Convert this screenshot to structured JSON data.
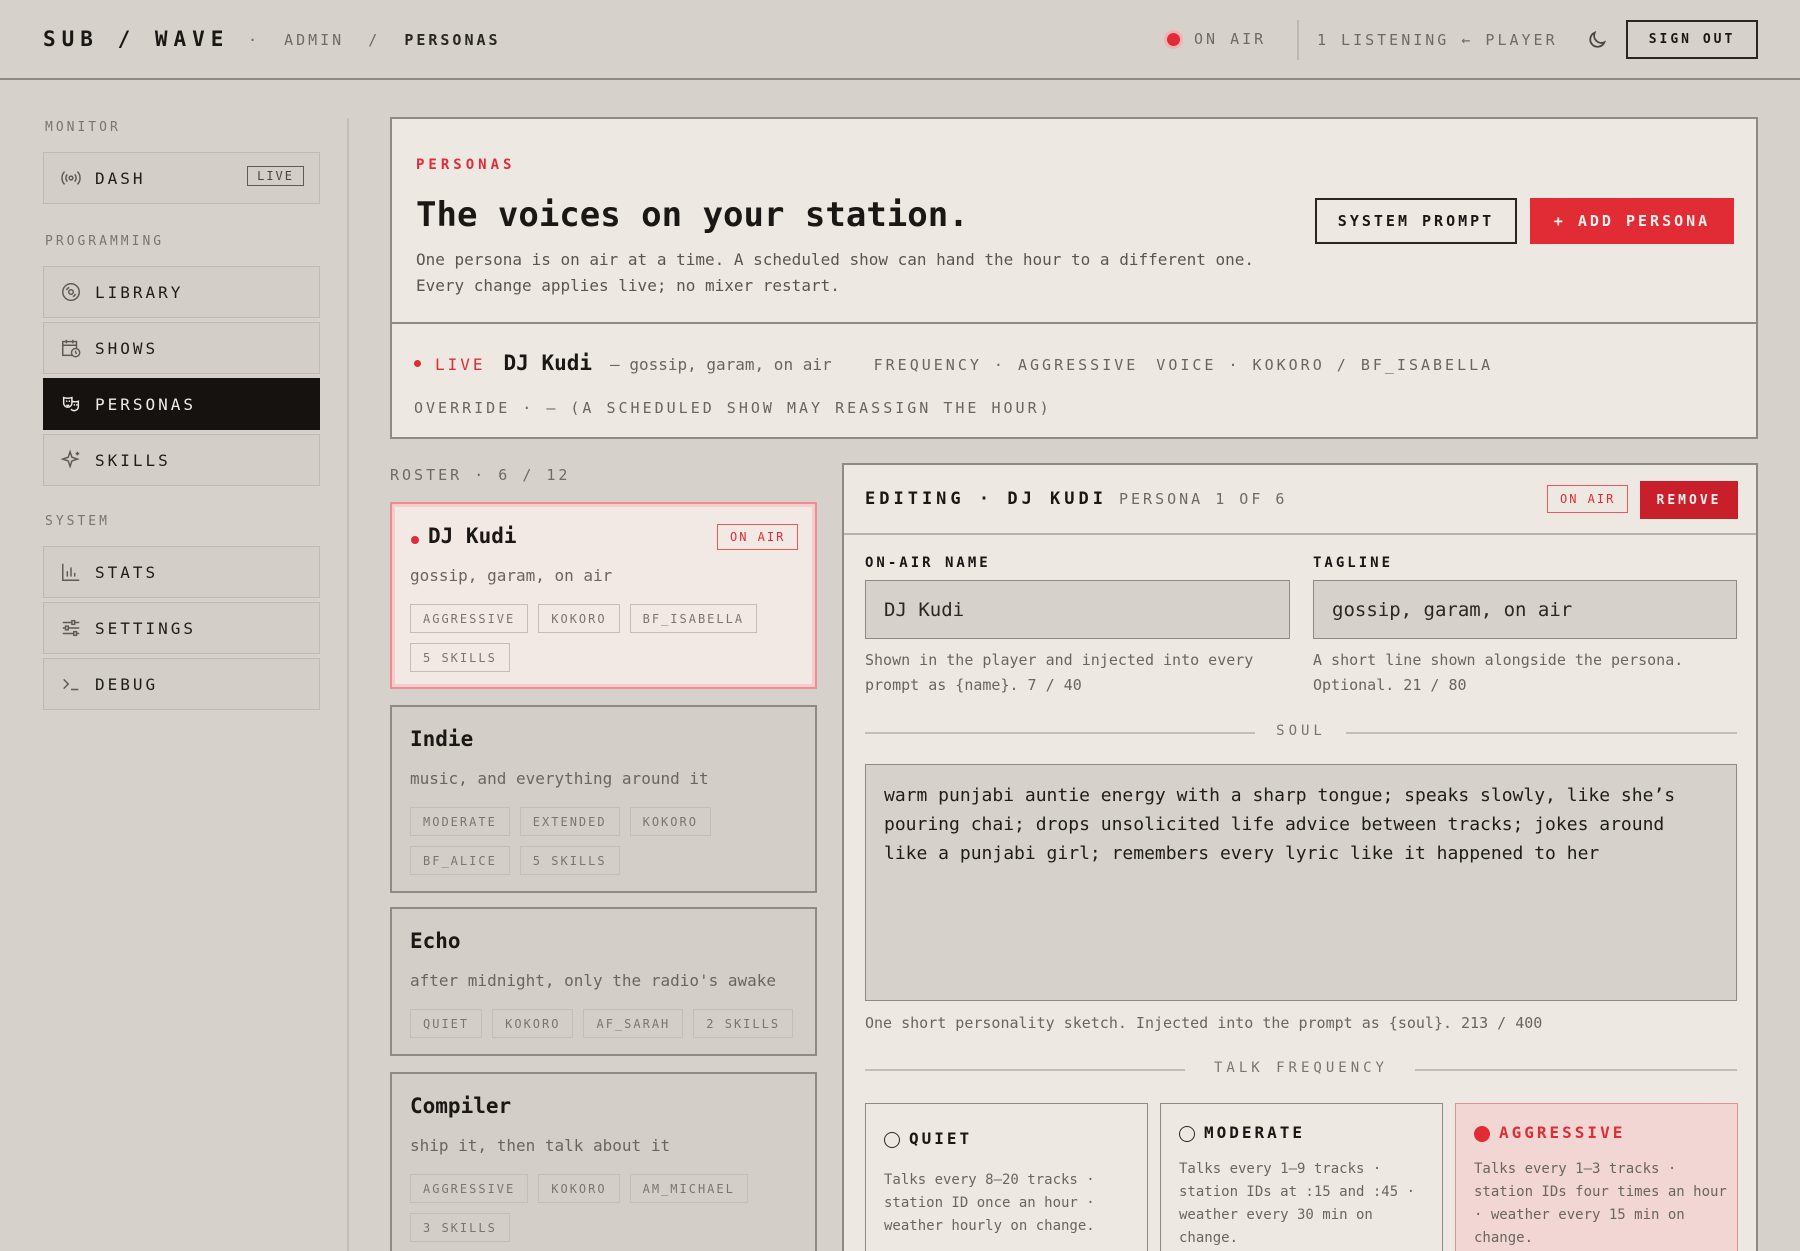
{
  "header": {
    "brand": "SUB / WAVE",
    "crumb_sep1": "·",
    "crumb_admin": "ADMIN",
    "crumb_sep2": "/",
    "crumb_current": "PERSONAS",
    "on_air": "ON AIR",
    "listening": "1 LISTENING ← PLAYER",
    "sign_out": "SIGN OUT"
  },
  "sidebar": {
    "monitor_label": "MONITOR",
    "programming_label": "PROGRAMMING",
    "system_label": "SYSTEM",
    "dash": "DASH",
    "live_badge": "LIVE",
    "library": "LIBRARY",
    "shows": "SHOWS",
    "personas": "PERSONAS",
    "skills": "SKILLS",
    "stats": "STATS",
    "settings": "SETTINGS",
    "debug": "DEBUG"
  },
  "hero": {
    "eyebrow": "PERSONAS",
    "title": "The voices on your station.",
    "description": "One persona is on air at a time. A scheduled show can hand the hour to a different one. Every change applies live; no mixer restart.",
    "system_prompt": "SYSTEM PROMPT",
    "add_persona": "+ ADD PERSONA",
    "live_word": "LIVE",
    "live_name": "DJ Kudi",
    "live_tagline": "— gossip, garam, on air",
    "live_frequency": "FREQUENCY · AGGRESSIVE",
    "live_voice": "VOICE · KOKORO / BF_ISABELLA",
    "override": "OVERRIDE · — (A SCHEDULED SHOW MAY REASSIGN THE HOUR)"
  },
  "roster": {
    "label": "ROSTER · 6 / 12",
    "personas": [
      {
        "name": "DJ Kudi",
        "tagline": "gossip, garam, on air",
        "on_air": "ON AIR",
        "chips": [
          "AGGRESSIVE",
          "KOKORO",
          "BF_ISABELLA",
          "5 SKILLS"
        ]
      },
      {
        "name": "Indie",
        "tagline": "music, and everything around it",
        "chips": [
          "MODERATE",
          "EXTENDED",
          "KOKORO",
          "BF_ALICE",
          "5 SKILLS"
        ]
      },
      {
        "name": "Echo",
        "tagline": "after midnight, only the radio's awake",
        "chips": [
          "QUIET",
          "KOKORO",
          "AF_SARAH",
          "2 SKILLS"
        ]
      },
      {
        "name": "Compiler",
        "tagline": "ship it, then talk about it",
        "chips": [
          "AGGRESSIVE",
          "KOKORO",
          "AM_MICHAEL",
          "3 SKILLS"
        ]
      }
    ]
  },
  "editor": {
    "title": "EDITING · DJ KUDI",
    "subtitle": "PERSONA 1 OF 6",
    "on_air": "ON AIR",
    "remove": "REMOVE",
    "name_label": "ON-AIR NAME",
    "name_value": "DJ Kudi",
    "name_hint": "Shown in the player and injected into every prompt as {name}. 7 / 40",
    "tagline_label": "TAGLINE",
    "tagline_value": "gossip, garam, on air",
    "tagline_hint": "A short line shown alongside the persona. Optional. 21 / 80",
    "soul_label": "SOUL",
    "soul_value": "warm punjabi auntie energy with a sharp tongue; speaks slowly, like she’s pouring chai; drops unsolicited life advice between tracks; jokes around like a punjabi girl; remembers every lyric like it happened to her",
    "soul_hint": "One short personality sketch. Injected into the prompt as {soul}. 213 / 400",
    "freq_label": "TALK FREQUENCY",
    "frequencies": [
      {
        "name": "QUIET",
        "desc": "Talks every 8–20 tracks · station ID once an hour · weather hourly on change."
      },
      {
        "name": "MODERATE",
        "desc": "Talks every 1–9 tracks · station IDs at :15 and :45 · weather every 30 min on change."
      },
      {
        "name": "AGGRESSIVE",
        "desc": "Talks every 1–3 tracks · station IDs four times an hour · weather every 15 min on change."
      }
    ],
    "selected_frequency": "AGGRESSIVE"
  },
  "colors": {
    "accent": "#e12c36",
    "ink": "#1a1715",
    "paper": "#ede9e2",
    "bg": "#d6d2cb"
  }
}
